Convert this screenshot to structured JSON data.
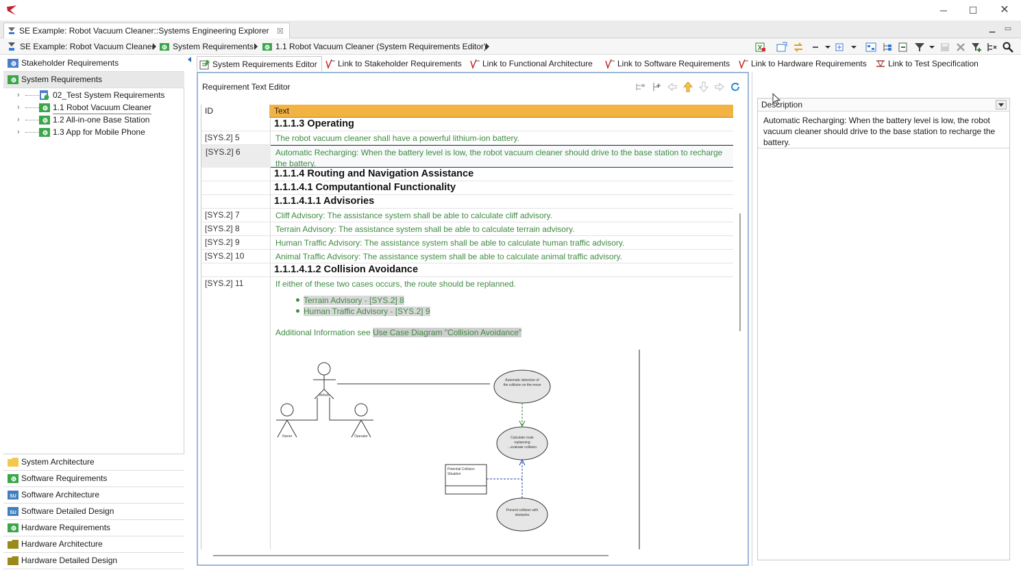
{
  "window": {
    "editor_tab": "SE Example: Robot Vacuum Cleaner::Systems Engineering Explorer",
    "minimize_glyph": "─",
    "maximize_glyph": "☐",
    "close_glyph": "✕",
    "tab_close_glyph": "☒"
  },
  "breadcrumb": [
    {
      "label": "SE Example: Robot Vacuum Cleaner",
      "icon": "se-explorer-icon"
    },
    {
      "label": "System Requirements",
      "icon": "requirements-package-icon"
    },
    {
      "label": "1.1 Robot Vacuum Cleaner  (System Requirements Editor)",
      "icon": "requirements-package-icon"
    }
  ],
  "toolbar": {
    "icons": [
      "excel-export-icon",
      "open-window-icon",
      "sync-icon",
      "collapse-icon",
      "dropdown-icon",
      "new-element-icon",
      "dropdown-icon",
      "diagram-icon",
      "tree-icon",
      "link-icon",
      "filter-icon",
      "dropdown-icon",
      "save-icon",
      "delete-icon",
      "filter-plus-icon",
      "hierarchy-icon",
      "search-icon"
    ]
  },
  "explorer": {
    "top_headers": [
      {
        "label": "Stakeholder Requirements",
        "icon": "requirements-package-icon",
        "color": "#4a7ec8"
      },
      {
        "label": "System Requirements",
        "icon": "requirements-package-icon",
        "color": "#3aa64a"
      }
    ],
    "tree": [
      {
        "label": "02_Test System Requirements",
        "icon": "requirements-doc-icon"
      },
      {
        "label": "1.1 Robot Vacuum Cleaner",
        "icon": "requirements-package-icon"
      },
      {
        "label": "1.2 All-in-one Base Station",
        "icon": "requirements-package-icon"
      },
      {
        "label": "1.3 App for Mobile Phone",
        "icon": "requirements-package-icon"
      }
    ],
    "bottom_headers": [
      {
        "label": "System Architecture",
        "icon": "folder-icon",
        "color": "#f2c94c"
      },
      {
        "label": "Software Requirements",
        "icon": "requirements-package-icon",
        "color": "#3aa64a"
      },
      {
        "label": "Software Architecture",
        "icon": "su-package-icon",
        "color": "#3f7fbf"
      },
      {
        "label": "Software Detailed Design",
        "icon": "su-package-icon",
        "color": "#3f7fbf"
      },
      {
        "label": "Hardware Requirements",
        "icon": "requirements-package-icon",
        "color": "#3aa64a"
      },
      {
        "label": "Hardware Architecture",
        "icon": "folder-icon",
        "color": "#9a8a1c"
      },
      {
        "label": "Hardware Detailed Design",
        "icon": "folder-icon",
        "color": "#9a8a1c"
      }
    ]
  },
  "editor": {
    "tabs": [
      {
        "label": "System Requirements Editor",
        "active": true
      },
      {
        "label": "Link to Stakeholder Requirements",
        "active": false
      },
      {
        "label": "Link to Functional Architecture",
        "active": false
      },
      {
        "label": "Link to Software Requirements",
        "active": false
      },
      {
        "label": "Link to Hardware Requirements",
        "active": false
      },
      {
        "label": "Link to Test Specification",
        "active": false
      }
    ],
    "panel_title": "Requirement Text Editor",
    "columns": {
      "id": "ID",
      "text": "Text"
    },
    "rows": [
      {
        "type": "heading",
        "id": "",
        "text": "1.1.1.3 Operating"
      },
      {
        "type": "req",
        "id": "[SYS.2] 5",
        "text": "The robot vacuum cleaner shall have a powerful lithium-ion battery."
      },
      {
        "type": "req",
        "id": "[SYS.2] 6",
        "text": "Automatic Recharging: When the battery level is low, the robot vacuum cleaner should drive to the base station to recharge the battery."
      },
      {
        "type": "heading",
        "id": "",
        "text": "1.1.1.4 Routing and Navigation Assistance"
      },
      {
        "type": "heading",
        "id": "",
        "text": "1.1.1.4.1 Computantional Functionality"
      },
      {
        "type": "heading",
        "id": "",
        "text": "1.1.1.4.1.1 Advisories"
      },
      {
        "type": "req",
        "id": "[SYS.2] 7",
        "text": "Cliff Advisory: The assistance system shall be able to calculate cliff advisory."
      },
      {
        "type": "req",
        "id": "[SYS.2] 8",
        "text": "Terrain Advisory: The assistance system shall be able to calculate terrain advisory."
      },
      {
        "type": "req",
        "id": "[SYS.2] 9",
        "text": "Human Traffic Advisory: The assistance system shall be able to calculate human traffic advisory."
      },
      {
        "type": "req",
        "id": "[SYS.2] 10",
        "text": "Animal Traffic Advisory: The assistance system shall be able to calculate animal traffic advisory."
      },
      {
        "type": "heading",
        "id": "",
        "text": "1.1.1.4.1.2 Collision Avoidance"
      },
      {
        "type": "req",
        "id": "[SYS.2] 11",
        "text": "If either of these two cases occurs, the route should be replanned."
      }
    ],
    "bullets": [
      "Terrain Advisory - [SYS.2] 8",
      "Human Traffic Advisory - [SYS.2] 9"
    ],
    "additional_prefix": "Additional Information see ",
    "additional_link": "Use Case Diagram \"Collision Avoidance\""
  },
  "properties": {
    "header": "Description",
    "text": "Automatic Recharging: When the battery level is low, the robot vacuum cleaner should drive to the base station to recharge the battery."
  },
  "colors": {
    "requirement_text": "#3f8a43",
    "grid_header": "#f3b342",
    "panel_border": "#9bb7d8"
  }
}
